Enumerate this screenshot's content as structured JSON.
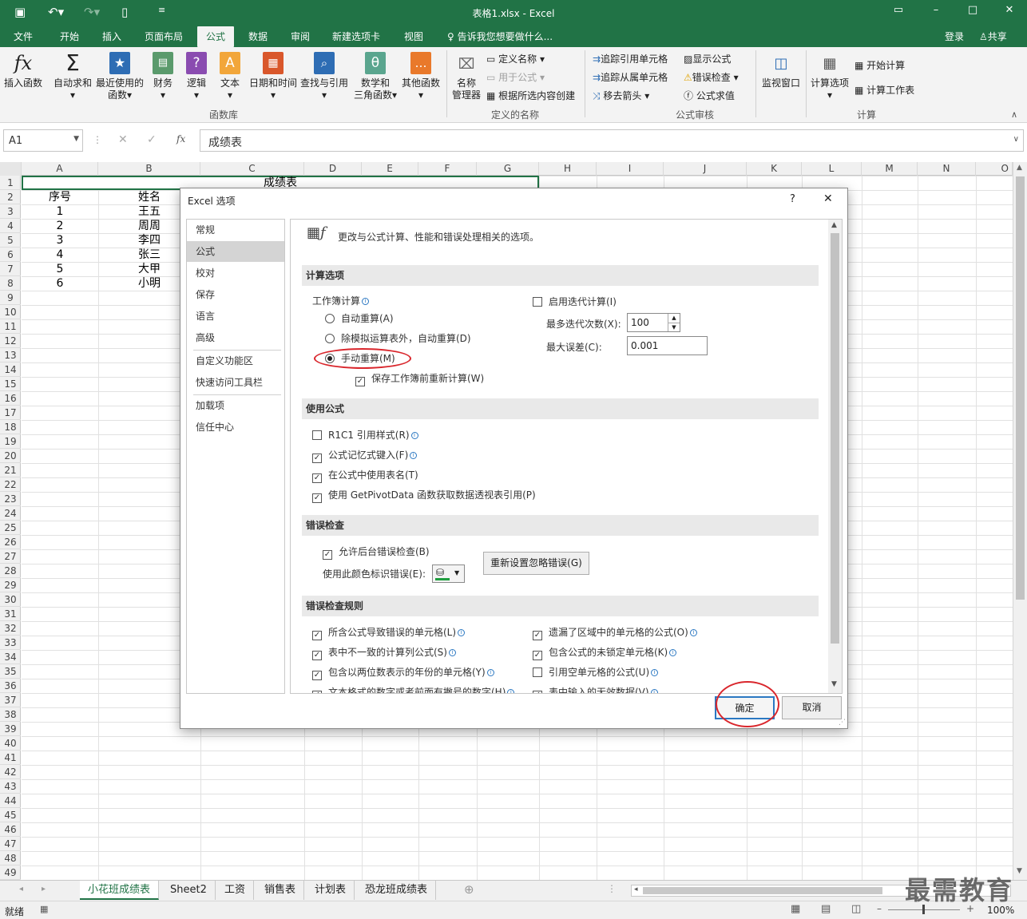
{
  "title": {
    "text": "表格1.xlsx - Excel",
    "login": "登录",
    "share": "共享"
  },
  "menu": {
    "tabs": [
      "文件",
      "开始",
      "插入",
      "页面布局",
      "公式",
      "数据",
      "审阅",
      "新建选项卡",
      "视图"
    ],
    "active": "公式",
    "search": "告诉我您想要做什么..."
  },
  "ribbon": {
    "big_buttons": [
      {
        "label": "插入函数",
        "label2": ""
      },
      {
        "label": "自动求和",
        "label2": "▾"
      },
      {
        "label": "最近使用的",
        "label2": "函数▾"
      },
      {
        "label": "财务",
        "label2": "▾"
      },
      {
        "label": "逻辑",
        "label2": "▾"
      },
      {
        "label": "文本",
        "label2": "▾"
      },
      {
        "label": "日期和时间",
        "label2": "▾"
      },
      {
        "label": "查找与引用",
        "label2": "▾"
      },
      {
        "label": "数学和",
        "label2": "三角函数▾"
      },
      {
        "label": "其他函数",
        "label2": "▾"
      }
    ],
    "name_mgr": {
      "label": "名称",
      "label2": "管理器"
    },
    "define_name": [
      "定义名称 ▾",
      "用于公式 ▾",
      "根据所选内容创建"
    ],
    "audit": [
      "追踪引用单元格",
      "追踪从属单元格",
      "移去箭头 ▾",
      "显示公式",
      "错误检查 ▾",
      "公式求值"
    ],
    "watch": "监视窗口",
    "calc_options": {
      "label": "计算选项",
      "label2": "▾"
    },
    "calc": [
      "开始计算",
      "计算工作表"
    ],
    "groups": [
      "函数库",
      "定义的名称",
      "公式审核",
      "计算"
    ]
  },
  "formula_bar": {
    "name_box": "A1",
    "fx": "fx",
    "content": "成绩表"
  },
  "grid": {
    "columns": [
      "A",
      "B",
      "C",
      "D",
      "E",
      "F",
      "G",
      "H",
      "I",
      "J",
      "K",
      "L",
      "M",
      "N",
      "O"
    ],
    "rows": [
      "1",
      "2",
      "3",
      "4",
      "5",
      "6",
      "7",
      "8",
      "9",
      "10",
      "11",
      "12",
      "13",
      "14",
      "15",
      "16",
      "17",
      "18",
      "19",
      "20",
      "21",
      "22",
      "23",
      "24",
      "25",
      "26",
      "27",
      "28",
      "29",
      "30",
      "31",
      "32",
      "33",
      "34",
      "35",
      "36",
      "37",
      "38",
      "39",
      "40",
      "41",
      "42",
      "43",
      "44",
      "45",
      "46",
      "47",
      "48",
      "49"
    ],
    "title_cell": "成绩表",
    "header": [
      "序号",
      "姓名"
    ],
    "data": [
      [
        "1",
        "王五"
      ],
      [
        "2",
        "周周"
      ],
      [
        "3",
        "李四"
      ],
      [
        "4",
        "张三"
      ],
      [
        "5",
        "大甲"
      ],
      [
        "6",
        "小明"
      ]
    ]
  },
  "dialog": {
    "title": "Excel 选项",
    "help": "?",
    "close": "✕",
    "nav": [
      "常规",
      "公式",
      "校对",
      "保存",
      "语言",
      "高级",
      "自定义功能区",
      "快速访问工具栏",
      "加载项",
      "信任中心"
    ],
    "selected_nav": "公式",
    "intro": "更改与公式计算、性能和错误处理相关的选项。",
    "sections": {
      "calc": "计算选项",
      "use_formula": "使用公式",
      "error_check": "错误检查",
      "error_rules": "错误检查规则"
    },
    "workbook_calc_label": "工作簿计算",
    "radios": [
      "自动重算(A)",
      "除模拟运算表外，自动重算(D)",
      "手动重算(M)"
    ],
    "selected_radio": "手动重算(M)",
    "save_recalc": "保存工作簿前重新计算(W)",
    "iter": {
      "label": "启用迭代计算(I)",
      "max_iter_label": "最多迭代次数(X):",
      "max_iter": "100",
      "max_change_label": "最大误差(C):",
      "max_change": "0.001"
    },
    "use_formula_opts": [
      "R1C1 引用样式(R)",
      "公式记忆式键入(F)",
      "在公式中使用表名(T)",
      "使用 GetPivotData 函数获取数据透视表引用(P)"
    ],
    "error_opts": {
      "bg": "允许后台错误检查(B)",
      "color_label": "使用此颜色标识错误(E):",
      "reset": "重新设置忽略错误(G)"
    },
    "rules_left": [
      "所含公式导致错误的单元格(L)",
      "表中不一致的计算列公式(S)",
      "包含以两位数表示的年份的单元格(Y)",
      "文本格式的数字或者前面有撇号的数字(H)"
    ],
    "rules_right": [
      "遗漏了区域中的单元格的公式(O)",
      "包含公式的未锁定单元格(K)",
      "引用空单元格的公式(U)",
      "表中输入的无效数据(V)"
    ],
    "ok": "确定",
    "cancel": "取消"
  },
  "sheets": [
    "小花班成绩表",
    "Sheet2",
    "工资",
    "销售表",
    "计划表",
    "恐龙班成绩表"
  ],
  "active_sheet": "小花班成绩表",
  "status": {
    "ready": "就绪",
    "zoom": "100%"
  },
  "watermark": "最需教育",
  "colors": {
    "brand": "#217346",
    "annotation": "#d9262c"
  }
}
